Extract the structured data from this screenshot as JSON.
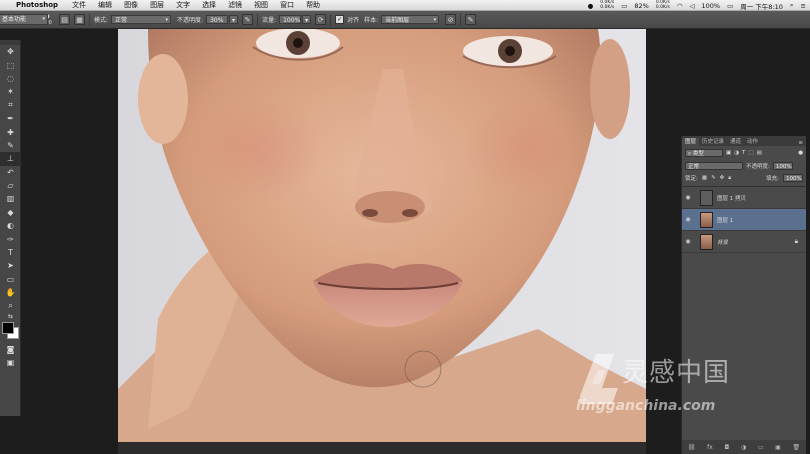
{
  "menubar": {
    "app_name": "Photoshop",
    "menus": [
      "文件",
      "编辑",
      "图像",
      "图层",
      "文字",
      "选择",
      "滤镜",
      "视图",
      "窗口",
      "帮助"
    ],
    "net_up": "0.0K/s",
    "net_down": "0.0K/s",
    "battery": "82%",
    "net2_up": "0.0K/s",
    "net2_down": "0.0K/s",
    "charge": "100%",
    "clock": "周一 下午8:10"
  },
  "options": {
    "brush_size": "400",
    "mode_label": "模式:",
    "mode_value": "正常",
    "opacity_label": "不透明度:",
    "opacity_value": "30%",
    "flow_label": "流量:",
    "flow_value": "100%",
    "aligned_label": "对齐",
    "sample_label": "样本:",
    "sample_value": "当前图层",
    "workspace": "基本功能"
  },
  "tool_icons": [
    "move-icon",
    "marquee-icon",
    "lasso-icon",
    "magic-wand-icon",
    "crop-icon",
    "eyedropper-icon",
    "healing-brush-icon",
    "brush-icon",
    "clone-stamp-icon",
    "history-brush-icon",
    "eraser-icon",
    "gradient-icon",
    "blur-icon",
    "dodge-icon",
    "pen-icon",
    "type-icon",
    "path-selection-icon",
    "shape-icon",
    "hand-icon",
    "zoom-icon"
  ],
  "layers_panel": {
    "tabs": [
      "图层",
      "历史记录",
      "通道",
      "动作"
    ],
    "kind_label": "类型",
    "blend_mode": "正常",
    "opacity_label": "不透明度:",
    "opacity_value": "100%",
    "lock_label": "锁定:",
    "fill_label": "填充:",
    "fill_value": "100%",
    "layers": [
      {
        "name": "图层 1 拷贝",
        "selected": false,
        "visible": true
      },
      {
        "name": "图层 1",
        "selected": true,
        "visible": true
      },
      {
        "name": "背景",
        "selected": false,
        "visible": true,
        "locked": true
      }
    ]
  },
  "watermark": {
    "title": "灵感中国",
    "url": "lingganchina.com"
  },
  "colors": {
    "selected_layer": "#5b6f8e",
    "panel_bg": "#4a4a4a",
    "app_bg": "#1d1d1d"
  }
}
